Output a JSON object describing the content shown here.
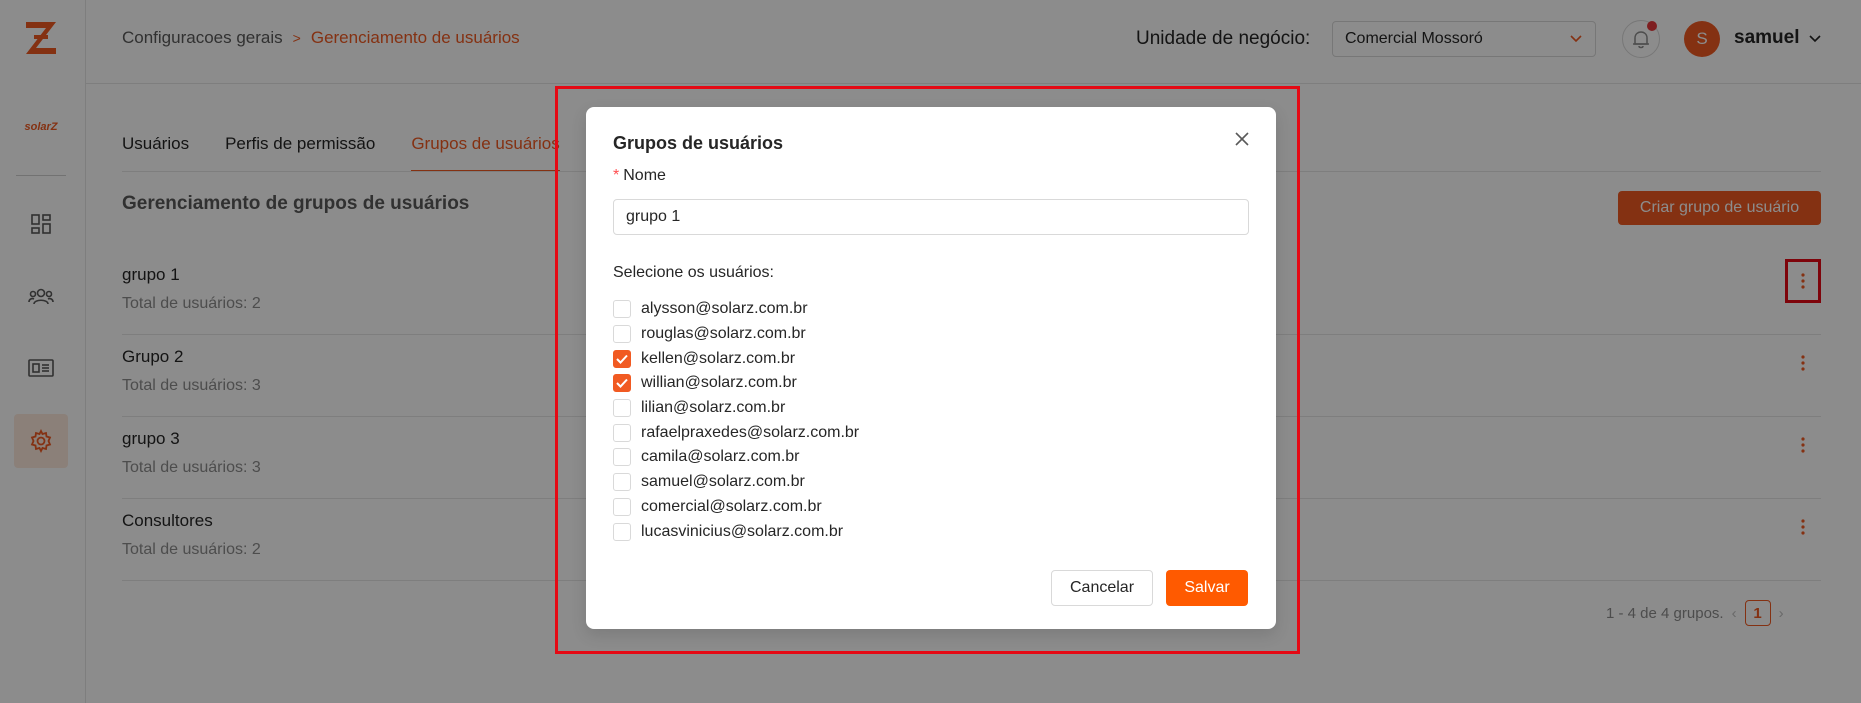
{
  "colors": {
    "accent": "#f15a22",
    "save_button": "#ff5a00",
    "annotation": "#e50914"
  },
  "sidebar": {
    "brand_text": "solarZ",
    "items": [
      {
        "icon": "dashboard-icon"
      },
      {
        "icon": "users-icon"
      },
      {
        "icon": "list-icon"
      },
      {
        "icon": "gear-icon",
        "active": true
      }
    ]
  },
  "header": {
    "breadcrumb": {
      "parent": "Configuracoes gerais",
      "separator": ">",
      "current": "Gerenciamento de usuários"
    },
    "business_unit_label": "Unidade de negócio:",
    "business_unit_value": "Comercial Mossoró",
    "avatar_initial": "S",
    "user_name": "samuel"
  },
  "tabs": [
    {
      "label": "Usuários"
    },
    {
      "label": "Perfis de permissão"
    },
    {
      "label": "Grupos de usuários",
      "active": true
    }
  ],
  "main": {
    "section_title": "Gerenciamento de grupos de usuários",
    "create_button": "Criar grupo de usuário",
    "groups": [
      {
        "name": "grupo 1",
        "total": "Total de usuários: 2"
      },
      {
        "name": "Grupo 2",
        "total": "Total de usuários: 3"
      },
      {
        "name": "grupo 3",
        "total": "Total de usuários: 3"
      },
      {
        "name": "Consultores",
        "total": "Total de usuários: 2"
      }
    ],
    "pagination": {
      "summary": "1 - 4 de 4 grupos.",
      "current_page": "1"
    }
  },
  "modal": {
    "title": "Grupos de usuários",
    "required_mark": "*",
    "name_label": "Nome",
    "name_value": "grupo 1",
    "users_label": "Selecione os usuários:",
    "users": [
      {
        "email": "alysson@solarz.com.br",
        "checked": false
      },
      {
        "email": "rouglas@solarz.com.br",
        "checked": false
      },
      {
        "email": "kellen@solarz.com.br",
        "checked": true
      },
      {
        "email": "willian@solarz.com.br",
        "checked": true
      },
      {
        "email": "lilian@solarz.com.br",
        "checked": false
      },
      {
        "email": "rafaelpraxedes@solarz.com.br",
        "checked": false
      },
      {
        "email": "camila@solarz.com.br",
        "checked": false
      },
      {
        "email": "samuel@solarz.com.br",
        "checked": false
      },
      {
        "email": "comercial@solarz.com.br",
        "checked": false
      },
      {
        "email": "lucasvinicius@solarz.com.br",
        "checked": false
      }
    ],
    "cancel_label": "Cancelar",
    "save_label": "Salvar"
  }
}
